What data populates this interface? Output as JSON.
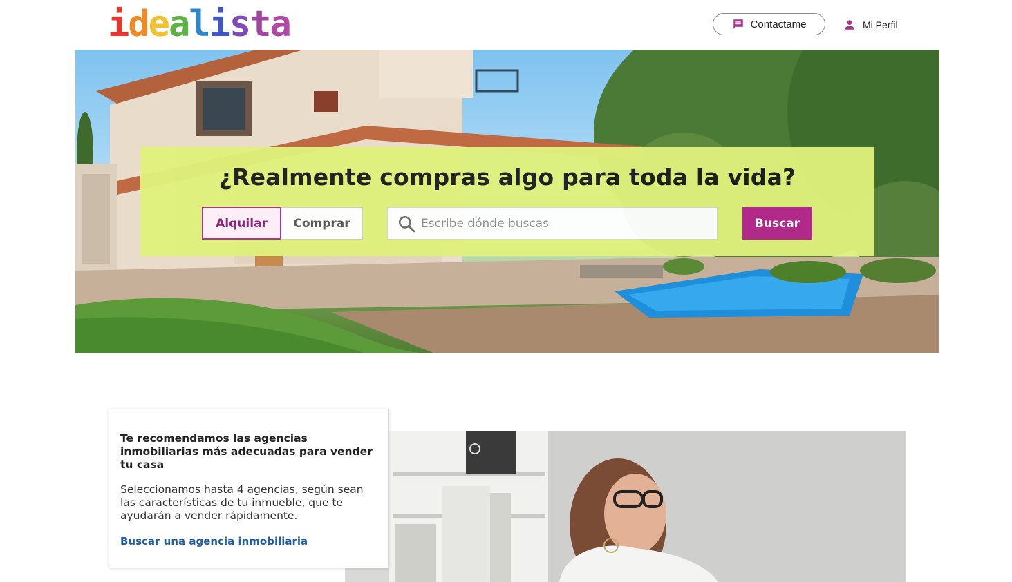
{
  "header": {
    "logo_letters": [
      {
        "char": "i",
        "color": "#e8362d"
      },
      {
        "char": "d",
        "color": "#f08a24"
      },
      {
        "char": "e",
        "color": "#f2c12e"
      },
      {
        "char": "a",
        "color": "#5fb246"
      },
      {
        "char": "l",
        "color": "#2f86c9"
      },
      {
        "char": "i",
        "color": "#3f57c4"
      },
      {
        "char": "s",
        "color": "#7e4bb8"
      },
      {
        "char": "t",
        "color": "#a0469f"
      },
      {
        "char": "a",
        "color": "#b04aa6"
      }
    ],
    "contact_label": "Contactame",
    "contact_icon": "chat-bubble-icon",
    "profile_label": "Mi Perfil",
    "profile_icon": "user-icon",
    "icon_color": "#a8328c"
  },
  "hero": {
    "title": "¿Realmente compras algo para toda la vida?",
    "operations": [
      {
        "label": "Alquilar",
        "selected": true
      },
      {
        "label": "Comprar",
        "selected": false
      }
    ],
    "search_placeholder": "Escribe dónde buscas",
    "search_value": "",
    "search_button": "Buscar",
    "panel_color": "#dff17c",
    "accent_color": "#b6278d"
  },
  "agencies": {
    "title": "Te recomendamos las agencias inmobiliarias más adecuadas para vender tu casa",
    "description": "Seleccionamos hasta 4 agencias, según sean las características de tu inmueble, que te ayudarán a vender rápidamente.",
    "link": "Buscar una agencia inmobiliaria",
    "link_color": "#1d5ea8"
  }
}
